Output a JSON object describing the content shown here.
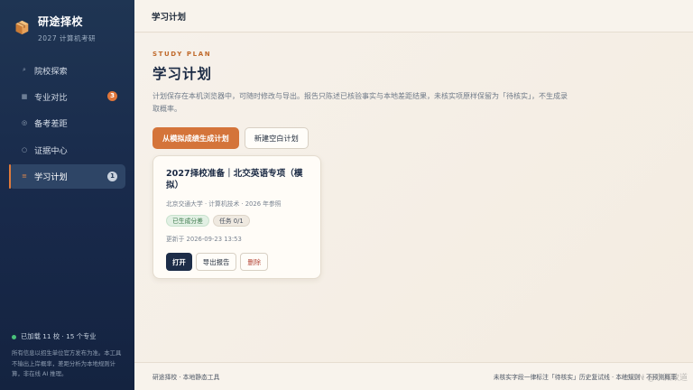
{
  "brand": {
    "title": "研途择校",
    "subtitle": "2027 计算机考研",
    "icon": "box-icon"
  },
  "sidebar": {
    "items": [
      {
        "label": "院校探索",
        "icon": "search-icon",
        "badge": "",
        "active": false
      },
      {
        "label": "专业对比",
        "icon": "grid-icon",
        "badge": "3",
        "active": false
      },
      {
        "label": "备考差距",
        "icon": "target-icon",
        "badge": "",
        "active": false
      },
      {
        "label": "证据中心",
        "icon": "circle-icon",
        "badge": "",
        "active": false
      },
      {
        "label": "学习计划",
        "icon": "list-icon",
        "badge": "1",
        "active": true
      }
    ],
    "status": "已加载 11 校 · 15 个专业",
    "note": "所有信息以招生单位官方发布为准。本工具不输出上岸概率，差距分析为本地规则计算，非在线 AI 推理。"
  },
  "topbar": {
    "title": "学习计划"
  },
  "main": {
    "eyebrow": "STUDY PLAN",
    "title": "学习计划",
    "description": "计划保存在本机浏览器中，可随时修改与导出。报告只陈述已核验事实与本地差距结果，未核实项原样保留为「待核实」，不生成录取概率。",
    "generate_button": "从模拟成绩生成计划",
    "new_button": "新建空白计划"
  },
  "plan_card": {
    "title": "2027择校准备｜北交英语专项（模拟）",
    "meta": "北京交通大学 · 计算机技术 · 2026 年参照",
    "tag_status": "已生成分差",
    "tag_tasks": "任务 0/1",
    "updated": "更新于 2026-09-23 13:53",
    "open_label": "打开",
    "export_label": "导出报告",
    "delete_label": "删除"
  },
  "footer": {
    "left": "研途择校 · 本地静态工具",
    "right": "未核实字段一律标注「待核实」历史复试线 · 本地规则 · 不预测概率"
  },
  "watermark": "CSDN @水渊致道",
  "colors": {
    "sidebar_bg": "#1f3553",
    "accent": "#d4743a",
    "badge_orange": "#e0763a",
    "dark_button": "#1d2d48",
    "danger": "#b5483a",
    "status_dot": "#49c27a"
  }
}
